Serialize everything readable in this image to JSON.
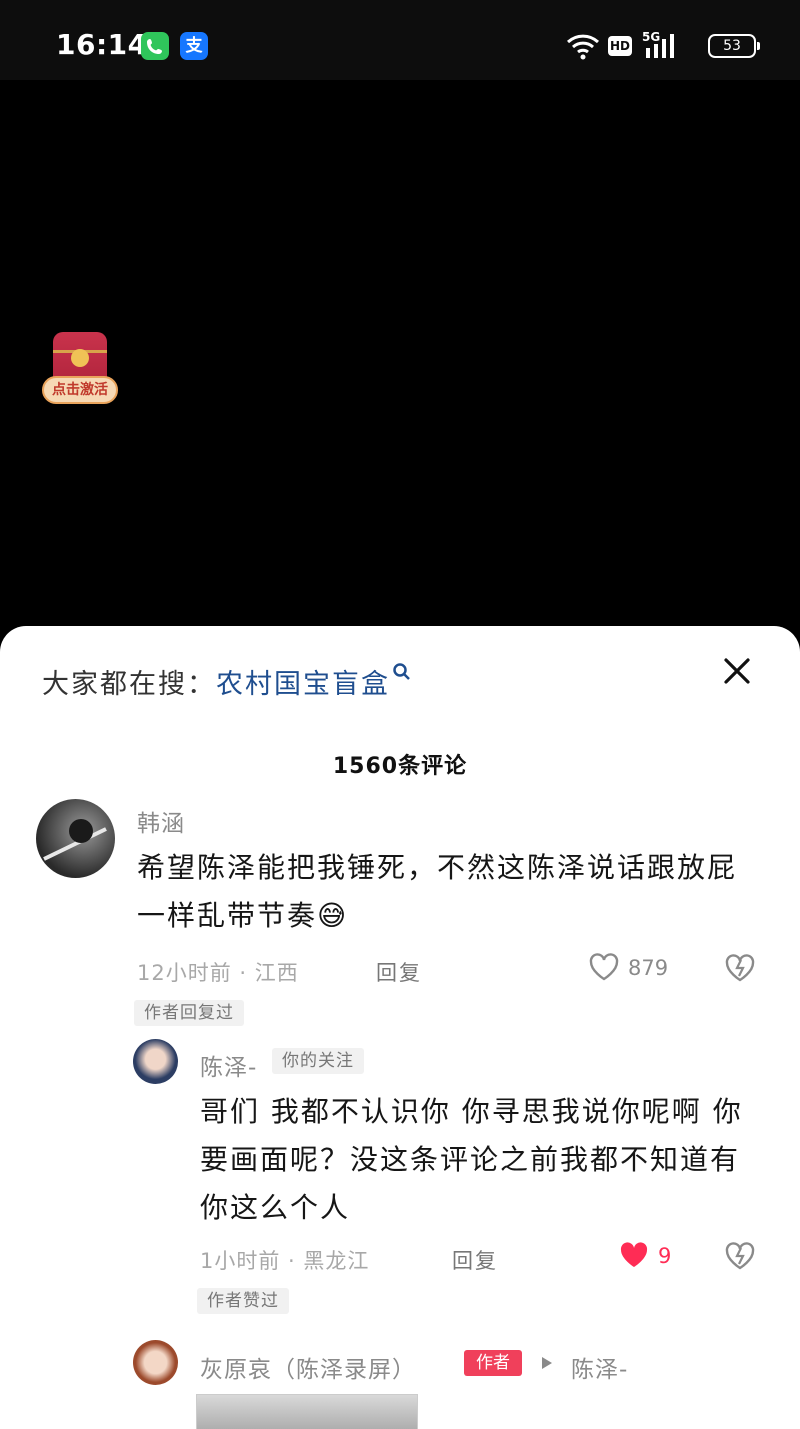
{
  "status_bar": {
    "time": "16:14",
    "battery": "53",
    "network": "5G",
    "hd": "HD",
    "app_icons": [
      "phone-icon",
      "alipay-icon"
    ],
    "pay_glyph": "支"
  },
  "floating": {
    "red_packet_label": "点击激活"
  },
  "sheet": {
    "search_prefix": "大家都在搜：",
    "search_keyword": "农村国宝盲盒",
    "comment_count": "1560条评论"
  },
  "comments": [
    {
      "user": "韩涵",
      "text": "希望陈泽能把我锤死，不然这陈泽说话跟放屁一样乱带节奏😅",
      "meta": "12小时前 · 江西",
      "reply": "回复",
      "likes": "879",
      "tag": "作者回复过"
    },
    {
      "user": "陈泽-",
      "user_tag": "你的关注",
      "text": "哥们 我都不认识你 你寻思我说你呢啊 你要画面呢？没这条评论之前我都不知道有你这么个人",
      "meta": "1小时前 · 黑龙江",
      "reply": "回复",
      "likes": "9",
      "liked": true,
      "tag": "作者赞过"
    },
    {
      "user": "灰原哀（陈泽录屏）",
      "badge": "作者",
      "reply_to": "陈泽-"
    }
  ],
  "colors": {
    "like_active": "#ff2c55",
    "author_badge": "#f0405b",
    "keyword": "#1f4e8f"
  }
}
